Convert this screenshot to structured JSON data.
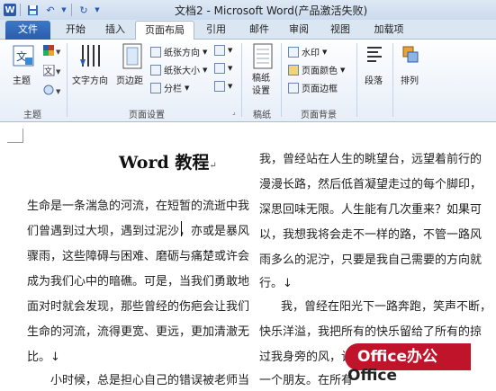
{
  "window": {
    "title": "文档2 - Microsoft Word(产品激活失败)"
  },
  "tabs": [
    {
      "label": "文件"
    },
    {
      "label": "开始"
    },
    {
      "label": "插入"
    },
    {
      "label": "页面布局"
    },
    {
      "label": "引用"
    },
    {
      "label": "邮件"
    },
    {
      "label": "审阅"
    },
    {
      "label": "视图"
    },
    {
      "label": "加载项"
    }
  ],
  "ribbon": {
    "theme_group": {
      "label": "主题",
      "theme_btn": "主题"
    },
    "page_setup": {
      "label": "页面设置",
      "text_direction": "文字方向",
      "margins": "页边距",
      "orientation": "纸张方向",
      "size": "纸张大小",
      "columns": "分栏"
    },
    "draft": {
      "label": "稿纸",
      "btn": "稿纸\n设置"
    },
    "page_bg": {
      "label": "页面背景",
      "watermark": "水印",
      "page_color": "页面颜色",
      "page_border": "页面边框"
    },
    "paragraph": {
      "btn": "段落"
    },
    "arrange": {
      "btn": "排列"
    }
  },
  "document": {
    "title": "Word 教程",
    "left_col": [
      "生命是一条湍急的河流，在短暂的流逝中我",
      "们曾遇到过大坝，遇到过泥沙，亦或是暴风",
      "骤雨，这些障碍与困难、磨砺与痛楚或许会",
      "成为我们心中的暗礁。可是，当我们勇敢地",
      "面对时就会发现，那些曾经的伤疤会让我们",
      "生命的河流，流得更宽、更远，更加清澈无",
      "比。↓",
      "小时候，总是担心自己的错误被老师当"
    ],
    "right_col": [
      "我，曾经站在人生的眺望台，远望着前行的",
      "漫漫长路，然后低首凝望走过的每个脚印，",
      "深思回味无限。人生能有几次重来？如果可",
      "以，我想我将会走不一样的路，不管一路风",
      "雨多么的泥泞，只要是我自己需要的方向就",
      "行。↓",
      "我，曾经在阳光下一路奔跑，笑声不断，",
      "快乐洋溢，我把所有的快乐留给了所有的掠",
      "过我身旁的风，让",
      "一个朋友。在所有"
    ]
  },
  "watermark_overlay": {
    "line1": "Office办公",
    "line2": "Office"
  }
}
